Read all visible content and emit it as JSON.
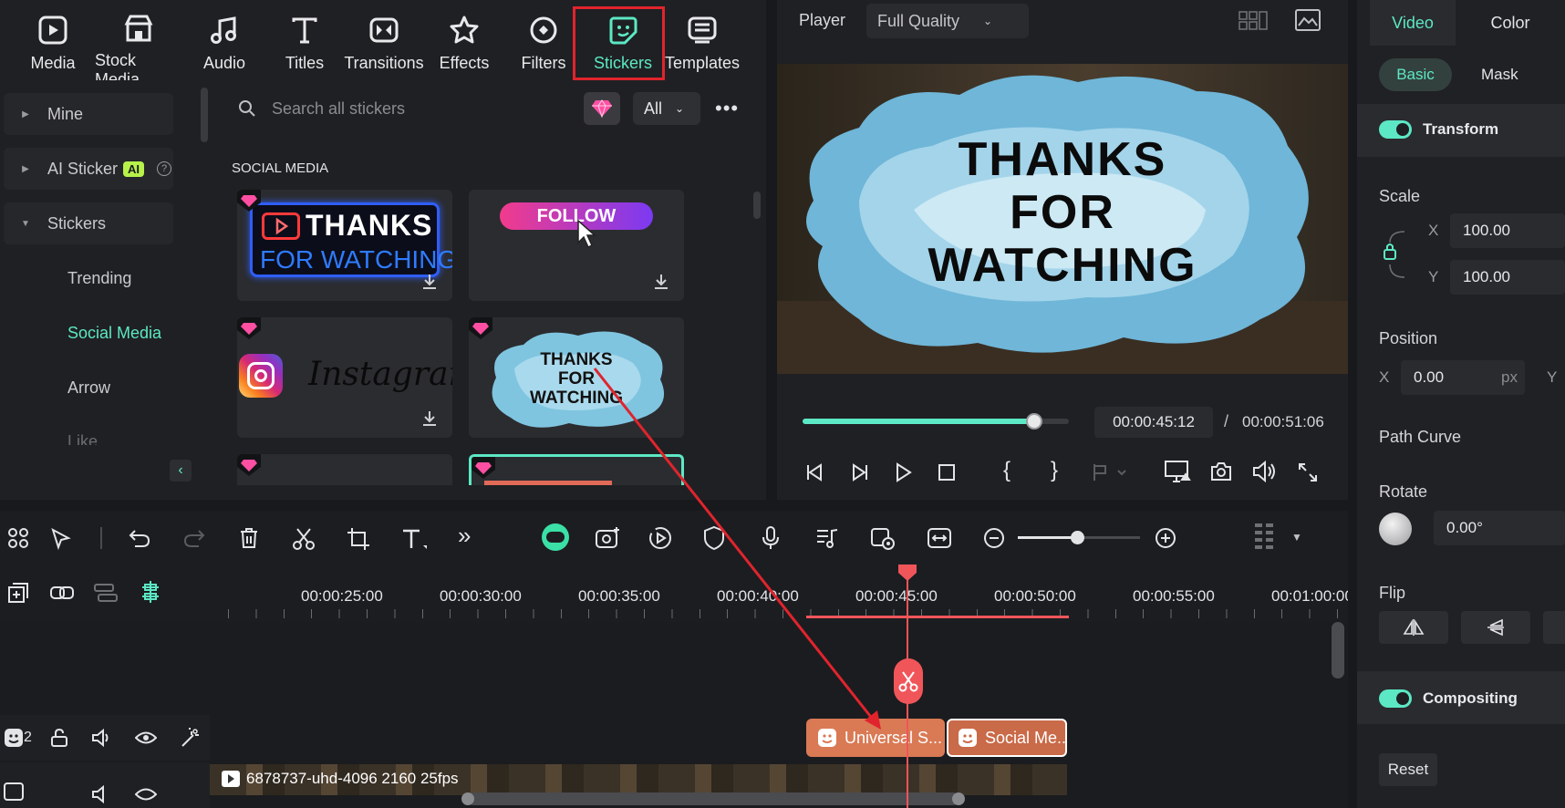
{
  "top_tabs": [
    {
      "label": "Media",
      "icon": "media-icon"
    },
    {
      "label": "Stock Media",
      "icon": "stock-media-icon"
    },
    {
      "label": "Audio",
      "icon": "audio-icon"
    },
    {
      "label": "Titles",
      "icon": "titles-icon"
    },
    {
      "label": "Transitions",
      "icon": "transitions-icon"
    },
    {
      "label": "Effects",
      "icon": "effects-icon"
    },
    {
      "label": "Filters",
      "icon": "filters-icon"
    },
    {
      "label": "Stickers",
      "icon": "stickers-icon",
      "active": true
    },
    {
      "label": "Templates",
      "icon": "templates-icon"
    }
  ],
  "sidebar": {
    "mine": "Mine",
    "ai_sticker": "AI Sticker",
    "ai_badge": "AI",
    "stickers": "Stickers",
    "sub": [
      "Trending",
      "Social Media",
      "Arrow",
      "Like"
    ]
  },
  "search": {
    "placeholder": "Search all stickers",
    "filter": "All"
  },
  "section_title": "SOCIAL MEDIA",
  "stickers": {
    "thanks_line1": "THANKS",
    "thanks_line2": "FOR WATCHING",
    "follow": "FOLLOW",
    "instagram": "Instagram",
    "splash_line1": "THANKS",
    "splash_line2": "FOR",
    "splash_line3": "WATCHING"
  },
  "player": {
    "label": "Player",
    "quality": "Full Quality",
    "overlay_line1": "THANKS",
    "overlay_line2": "FOR",
    "overlay_line3": "WATCHING",
    "current_time": "00:00:45:12",
    "separator": "/",
    "total_time": "00:00:51:06",
    "progress": 0.87
  },
  "ruler_ticks": [
    "00:00:25:00",
    "00:00:30:00",
    "00:00:35:00",
    "00:00:40:00",
    "00:00:45:00",
    "00:00:50:00",
    "00:00:55:00",
    "00:01:00:00"
  ],
  "tracks": {
    "track2_number": "2",
    "clip1": "Universal S...",
    "clip2": "Social Me...",
    "video_clip": "6878737-uhd-4096 2160 25fps"
  },
  "right_panel": {
    "tab_video": "Video",
    "tab_color": "Color",
    "sub_basic": "Basic",
    "sub_mask": "Mask",
    "transform": "Transform",
    "scale": "Scale",
    "scale_x_label": "X",
    "scale_x": "100.00",
    "scale_y_label": "Y",
    "scale_y": "100.00",
    "position": "Position",
    "pos_x_label": "X",
    "pos_x": "0.00",
    "pos_unit": "px",
    "pos_y_label": "Y",
    "path_curve": "Path Curve",
    "rotate": "Rotate",
    "rotate_value": "0.00°",
    "flip": "Flip",
    "compositing": "Compositing",
    "reset": "Reset"
  },
  "colors": {
    "accent": "#5ce8c4",
    "highlight": "#e0242d",
    "clip": "#d97a55",
    "playhead": "#f0555a"
  }
}
